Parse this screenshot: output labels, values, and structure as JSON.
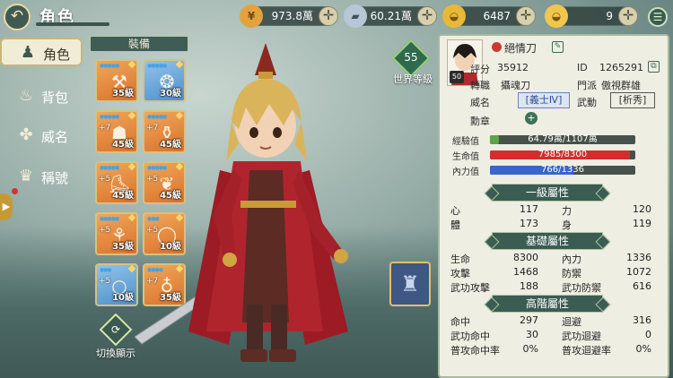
{
  "header": {
    "back_glyph": "↶",
    "title": "角色"
  },
  "resources": [
    {
      "icon": "coin-icon",
      "glyph": "¥",
      "value": "973.8萬",
      "color": "#e2a33f"
    },
    {
      "icon": "silver-ingot-icon",
      "glyph": "▰",
      "value": "60.21萬",
      "color": "#b7c7d6"
    },
    {
      "icon": "gold-ingot-icon",
      "glyph": "◒",
      "value": "6487",
      "color": "#e8b936"
    },
    {
      "icon": "gold-ingot-small-icon",
      "glyph": "◒",
      "value": "9",
      "color": "#f1c64c"
    }
  ],
  "plus_glyph": "✛",
  "menu_glyph": "☰",
  "nav": [
    {
      "label": "角色",
      "icon": "character-icon",
      "glyph": "♟",
      "active": true
    },
    {
      "label": "背包",
      "icon": "bag-icon",
      "glyph": "♨"
    },
    {
      "label": "威名",
      "icon": "fame-icon",
      "glyph": "✤"
    },
    {
      "label": "稱號",
      "icon": "title-icon",
      "glyph": "♛"
    }
  ],
  "equipment": {
    "header": "裝備",
    "slots": [
      {
        "level": "35級",
        "enh": "",
        "color": "orange",
        "art": "⚒",
        "gems": "●●●●●",
        "name": "equip-slot-1"
      },
      {
        "level": "30級",
        "enh": "",
        "color": "blue",
        "art": "❂",
        "gems": "●●●●●",
        "name": "equip-slot-2"
      },
      {
        "level": "45級",
        "enh": "+7",
        "color": "orange",
        "art": "☗",
        "gems": "●●●●●",
        "name": "equip-slot-3"
      },
      {
        "level": "45級",
        "enh": "+7",
        "color": "orange",
        "art": "⚱",
        "gems": "●●●●●",
        "name": "equip-slot-4"
      },
      {
        "level": "45級",
        "enh": "+5",
        "color": "orange",
        "art": "⛸",
        "gems": "●●●●●",
        "name": "equip-slot-5"
      },
      {
        "level": "45級",
        "enh": "+5",
        "color": "orange",
        "art": "❦",
        "gems": "●●●●●",
        "name": "equip-slot-6"
      },
      {
        "level": "35級",
        "enh": "+5",
        "color": "orange",
        "art": "⚘",
        "gems": "●●●●●",
        "name": "equip-slot-7"
      },
      {
        "level": "10級",
        "enh": "+5",
        "color": "orange",
        "art": "◯",
        "gems": "●●●",
        "name": "equip-slot-8"
      },
      {
        "level": "10級",
        "enh": "+5",
        "color": "blue",
        "art": "○",
        "gems": "●●●",
        "name": "equip-slot-9"
      },
      {
        "level": "35級",
        "enh": "+7",
        "color": "orange",
        "art": "♁",
        "gems": "●●●●",
        "name": "equip-slot-10"
      }
    ],
    "switch_label": "切換顯示",
    "switch_glyph": "⟳"
  },
  "world_level": {
    "value": "55",
    "label": "世界等級"
  },
  "costume_glyph": "♜",
  "profile": {
    "portrait_level": "50",
    "name": "絕情刀",
    "score_label": "評分",
    "score": "35912",
    "id_label": "ID",
    "id": "1265291",
    "job_label": "轉職",
    "job": "攝魂刀",
    "sect_label": "門派",
    "sect": "傲視群雄",
    "fame_label": "威名",
    "fame": "[義士Ⅳ]",
    "martial_label": "武動",
    "martial": "[析秀]",
    "medal_label": "勳章",
    "edit_glyph": "✎",
    "copy_glyph": "⧉",
    "add_glyph": "+"
  },
  "bars": [
    {
      "label": "經驗值",
      "value": "64.79萬/1107萬",
      "fill": 0.059,
      "color": "#5da34a"
    },
    {
      "label": "生命值",
      "value": "7985/8300",
      "fill": 0.962,
      "color": "#d42d2d"
    },
    {
      "label": "內力值",
      "value": "766/1336",
      "fill": 0.573,
      "color": "#3767c9"
    }
  ],
  "primary_attrs": {
    "title": "一級屬性",
    "rows": [
      [
        "心",
        "117",
        "力",
        "120"
      ],
      [
        "體",
        "173",
        "身",
        "119"
      ]
    ]
  },
  "base_attrs": {
    "title": "基礎屬性",
    "rows": [
      [
        "生命",
        "8300",
        "內力",
        "1336"
      ],
      [
        "攻擊",
        "1468",
        "防禦",
        "1072"
      ],
      [
        "武功攻擊",
        "188",
        "武功防禦",
        "616"
      ]
    ]
  },
  "advanced_attrs": {
    "title": "高階屬性",
    "rows": [
      [
        "命中",
        "297",
        "迴避",
        "316"
      ],
      [
        "武功命中",
        "30",
        "武功迴避",
        "0"
      ],
      [
        "普攻命中率",
        "0%",
        "普攻迴避率",
        "0%"
      ]
    ]
  }
}
